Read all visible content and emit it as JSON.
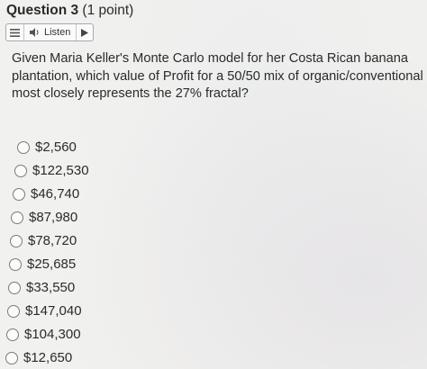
{
  "question": {
    "number": "Question 3",
    "points": "(1 point)",
    "text": "Given Maria Keller's Monte Carlo model for her Costa Rican banana plantation, which value of Profit for a 50/50 mix of organic/conventional most closely represents the 27% fractal?"
  },
  "tts": {
    "menu_icon": "menu-lines-icon",
    "speaker_icon": "speaker-icon",
    "listen_label": "Listen",
    "play_icon": "play-icon"
  },
  "options": [
    {
      "label": "$2,560"
    },
    {
      "label": "$122,530"
    },
    {
      "label": "$46,740"
    },
    {
      "label": "$87,980"
    },
    {
      "label": "$78,720"
    },
    {
      "label": "$25,685"
    },
    {
      "label": "$33,550"
    },
    {
      "label": "$147,040"
    },
    {
      "label": "$104,300"
    },
    {
      "label": "$12,650"
    }
  ]
}
